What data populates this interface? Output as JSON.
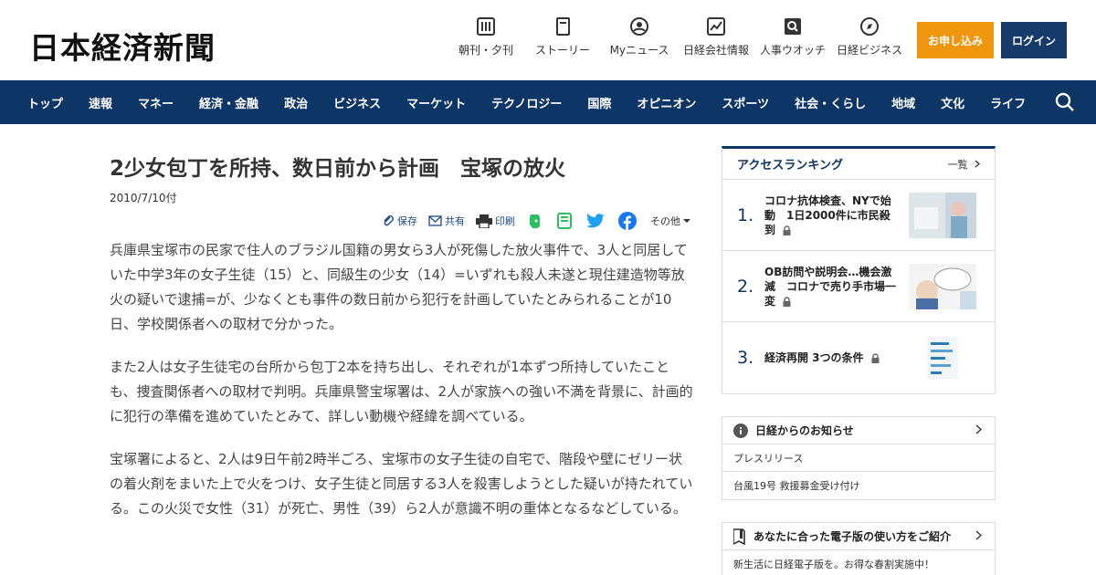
{
  "header": {
    "logo": "日本経済新聞",
    "icons": [
      {
        "label": "朝刊・夕刊",
        "icon": "newspaper-icon"
      },
      {
        "label": "ストーリー",
        "icon": "book-icon"
      },
      {
        "label": "Myニュース",
        "icon": "user-icon"
      },
      {
        "label": "日経会社情報",
        "icon": "chart-icon"
      },
      {
        "label": "人事ウオッチ",
        "icon": "magnifier-icon"
      },
      {
        "label": "日経ビジネス",
        "icon": "compass-icon"
      }
    ],
    "apply_label": "お申し込み",
    "login_label": "ログイン"
  },
  "nav": {
    "items": [
      "トップ",
      "速報",
      "マネー",
      "経済・金融",
      "政治",
      "ビジネス",
      "マーケット",
      "テクノロジー",
      "国際",
      "オピニオン",
      "スポーツ",
      "社会・くらし",
      "地域",
      "文化",
      "ライフ"
    ]
  },
  "article": {
    "title": "2少女包丁を所持、数日前から計画　宝塚の放火",
    "date": "2010/7/10付",
    "share": {
      "save": "保存",
      "share": "共有",
      "print": "印刷",
      "other": "その他"
    },
    "paragraphs": [
      "兵庫県宝塚市の民家で住人のブラジル国籍の男女ら3人が死傷した放火事件で、3人と同居していた中学3年の女子生徒（15）と、同級生の少女（14）=いずれも殺人未遂と現住建造物等放火の疑いで逮捕=が、少なくとも事件の数日前から犯行を計画していたとみられることが10日、学校関係者への取材で分かった。",
      "また2人は女子生徒宅の台所から包丁2本を持ち出し、それぞれが1本ずつ所持していたことも、捜査関係者への取材で判明。兵庫県警宝塚署は、2人が家族への強い不満を背景に、計画的に犯行の準備を進めていたとみて、詳しい動機や経緯を調べている。",
      "宝塚署によると、2人は9日午前2時半ごろ、宝塚市の女子生徒の自宅で、階段や壁にゼリー状の着火剤をまいた上で火をつけ、女子生徒と同居する3人を殺害しようとした疑いが持たれている。この火災で女性（31）が死亡、男性（39）ら2人が意識不明の重体となるなどしている。"
    ]
  },
  "ranking": {
    "title": "アクセスランキング",
    "more": "一覧",
    "items": [
      {
        "num": "1.",
        "text": "コロナ抗体検査、NYで始動　1日2000件に市民殺到"
      },
      {
        "num": "2.",
        "text": "OB訪問や説明会…機会激減　コロナで売り手市場一変"
      },
      {
        "num": "3.",
        "text": "経済再開 3つの条件"
      }
    ]
  },
  "notice": {
    "title": "日経からのお知らせ",
    "rows": [
      "プレスリリース",
      "台風19号 救援募金受け付け"
    ]
  },
  "guide": {
    "title": "あなたに合った電子版の使い方をご紹介",
    "rows": [
      "新生活に日経電子版を。お得な春割実施中！"
    ]
  },
  "colors": {
    "nav_bg": "#0d3566",
    "apply_bg": "#f0960e",
    "login_bg": "#163b6a"
  }
}
